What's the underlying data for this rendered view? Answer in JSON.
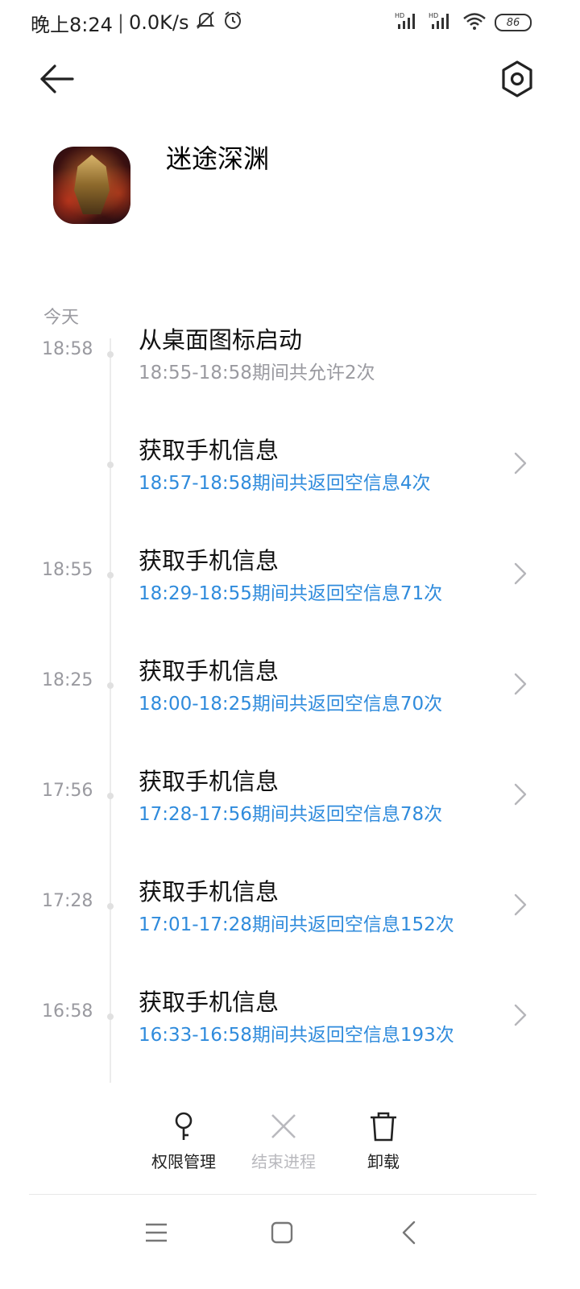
{
  "status_bar": {
    "time": "晚上8:24",
    "network_speed": "0.0K/s",
    "battery_level": "86",
    "icons": [
      "mute-icon",
      "alarm-icon",
      "signal-hd-icon",
      "signal-hd-icon",
      "wifi-icon",
      "battery-icon"
    ]
  },
  "header": {
    "back_icon": "back-arrow-icon",
    "settings_icon": "settings-icon"
  },
  "app": {
    "name": "迷途深渊"
  },
  "section": {
    "label": "今天"
  },
  "colors": {
    "accent_blue": "#2f8bdc",
    "secondary_gray": "#9a9aa0",
    "disabled_gray": "#b9b9be"
  },
  "entries": [
    {
      "time": "18:58",
      "title": "从桌面图标启动",
      "subtitle": "18:55-18:58期间共允许2次",
      "subtitle_style": "gray",
      "has_chevron": false
    },
    {
      "time": "",
      "title": "获取手机信息",
      "subtitle": "18:57-18:58期间共返回空信息4次",
      "subtitle_style": "blue",
      "has_chevron": true
    },
    {
      "time": "18:55",
      "title": "获取手机信息",
      "subtitle": "18:29-18:55期间共返回空信息71次",
      "subtitle_style": "blue",
      "has_chevron": true
    },
    {
      "time": "18:25",
      "title": "获取手机信息",
      "subtitle": "18:00-18:25期间共返回空信息70次",
      "subtitle_style": "blue",
      "has_chevron": true
    },
    {
      "time": "17:56",
      "title": "获取手机信息",
      "subtitle": "17:28-17:56期间共返回空信息78次",
      "subtitle_style": "blue",
      "has_chevron": true
    },
    {
      "time": "17:28",
      "title": "获取手机信息",
      "subtitle": "17:01-17:28期间共返回空信息152次",
      "subtitle_style": "blue",
      "has_chevron": true
    },
    {
      "time": "16:58",
      "title": "获取手机信息",
      "subtitle": "16:33-16:58期间共返回空信息193次",
      "subtitle_style": "blue",
      "has_chevron": true
    }
  ],
  "actions": {
    "permissions": {
      "label": "权限管理",
      "icon": "key-icon",
      "enabled": true
    },
    "force_stop": {
      "label": "结束进程",
      "icon": "close-icon",
      "enabled": false
    },
    "uninstall": {
      "label": "卸载",
      "icon": "trash-icon",
      "enabled": true
    }
  },
  "nav_bar": {
    "icons": [
      "menu-icon",
      "home-icon",
      "back-icon"
    ]
  }
}
